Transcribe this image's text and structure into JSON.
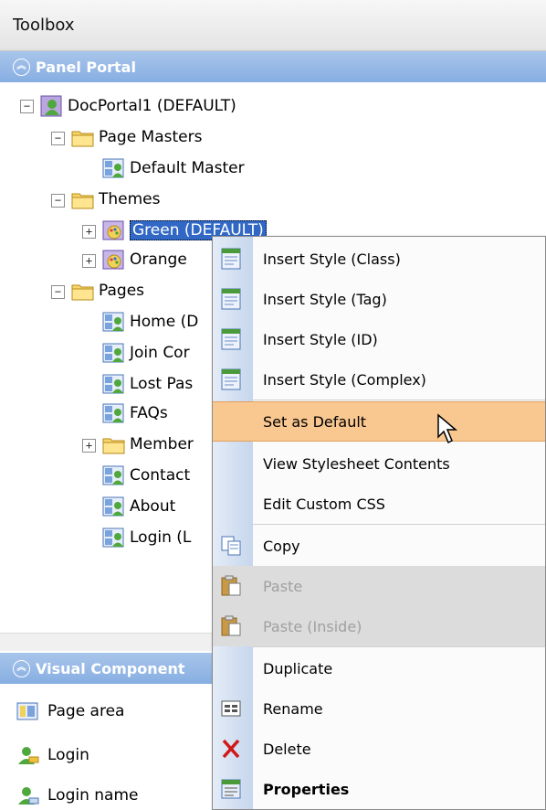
{
  "toolbox": {
    "title": "Toolbox"
  },
  "panel_portal": {
    "header": "Panel Portal",
    "tree": {
      "root": "DocPortal1 (DEFAULT)",
      "page_masters": "Page Masters",
      "default_master": "Default Master",
      "themes": "Themes",
      "green": "Green (DEFAULT)",
      "orange": "Orange",
      "pages": "Pages",
      "home": "Home (D",
      "join": "Join Cor",
      "lost": "Lost Pas",
      "faqs": "FAQs",
      "member": "Member",
      "contact": "Contact",
      "about": "About",
      "login": "Login (L"
    }
  },
  "visual_components": {
    "header": "Visual Component",
    "items": [
      "Page area",
      "Login",
      "Login name"
    ]
  },
  "context_menu": {
    "insert_class": "Insert Style (Class)",
    "insert_tag": "Insert Style (Tag)",
    "insert_id": "Insert Style (ID)",
    "insert_complex": "Insert Style (Complex)",
    "set_default": "Set as Default",
    "view_stylesheet": "View Stylesheet Contents",
    "edit_css": "Edit Custom CSS",
    "copy": "Copy",
    "paste": "Paste",
    "paste_inside": "Paste (Inside)",
    "duplicate": "Duplicate",
    "rename": "Rename",
    "delete": "Delete",
    "properties": "Properties"
  }
}
